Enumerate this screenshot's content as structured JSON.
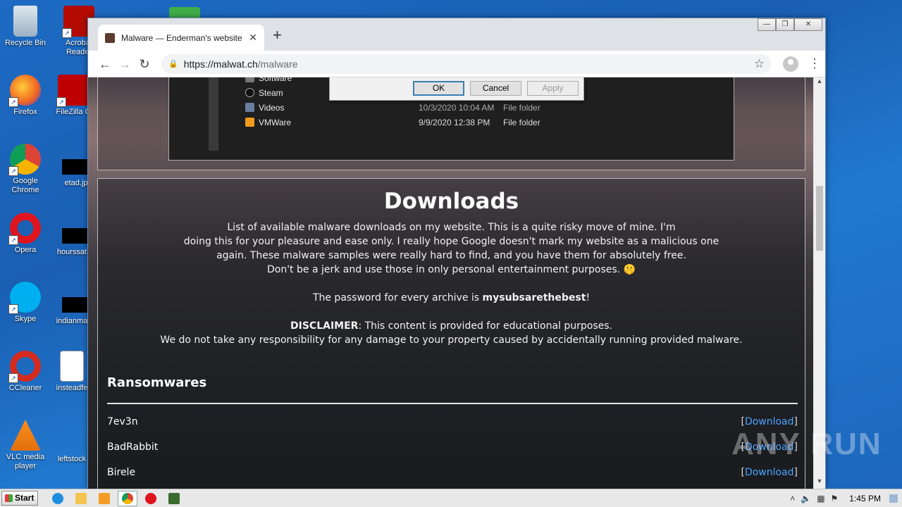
{
  "desktop": {
    "icons": [
      {
        "label": "Recycle Bin"
      },
      {
        "label": "Acrobat Reader"
      },
      {
        "label": "Firefox"
      },
      {
        "label": "FileZilla C"
      },
      {
        "label": "Google Chrome"
      },
      {
        "label": "etad.jp"
      },
      {
        "label": "Opera"
      },
      {
        "label": "hourssat"
      },
      {
        "label": "Skype"
      },
      {
        "label": "indianma"
      },
      {
        "label": "CCleaner"
      },
      {
        "label": "insteadfe"
      },
      {
        "label": "VLC media player"
      },
      {
        "label": "leftstock"
      }
    ]
  },
  "browser": {
    "tab_title": "Malware — Enderman's website",
    "url_host": "https://malwat.ch",
    "url_path": "/malware"
  },
  "screenshot_section": {
    "rows": [
      {
        "name": "Software",
        "date": "",
        "type": ""
      },
      {
        "name": "Steam",
        "date": "",
        "type": ""
      },
      {
        "name": "Videos",
        "date": "10/3/2020 10:04 AM",
        "type": "File folder"
      },
      {
        "name": "VMWare",
        "date": "9/9/2020 12:38 PM",
        "type": "File folder"
      }
    ],
    "dialog": {
      "ok": "OK",
      "cancel": "Cancel",
      "apply": "Apply"
    }
  },
  "downloads": {
    "title": "Downloads",
    "intro": [
      "List of available malware downloads on my website. This is a quite risky move of mine. I'm",
      "doing this for your pleasure and ease only. I really hope Google doesn't mark my website as a malicious one",
      "again. These malware samples were really hard to find, and you have them for absolutely free.",
      "Don't be a jerk and use those in only personal entertainment purposes. 🤫"
    ],
    "password_prefix": "The password for every archive is ",
    "password": "mysubsarethebest",
    "password_suffix": "!",
    "disclaimer_label": "DISCLAIMER",
    "disclaimer_text": ": This content is provided for educational purposes.",
    "disclaimer_line2": "We do not take any responsibility for any damage to your property caused by accidentally running provided malware.",
    "section": "Ransomwares",
    "items": [
      {
        "name": "7ev3n",
        "link": "Download"
      },
      {
        "name": "BadRabbit",
        "link": "Download"
      },
      {
        "name": "Birele",
        "link": "Download"
      }
    ]
  },
  "watermark": "ANY RUN",
  "taskbar": {
    "start": "Start",
    "clock": "1:45 PM"
  }
}
